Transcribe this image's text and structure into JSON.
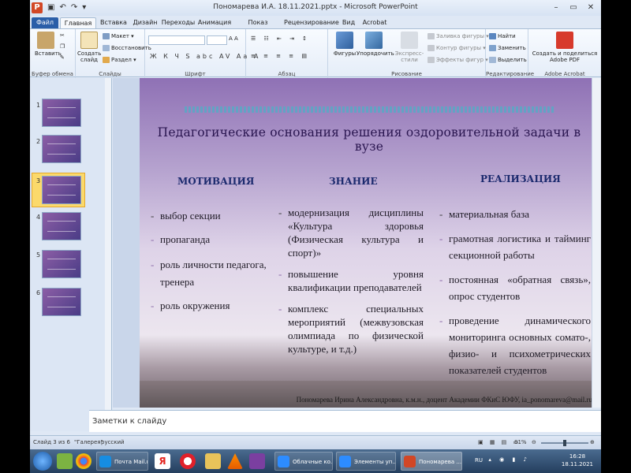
{
  "window": {
    "title": "Пономарева И.А. 18.11.2021.pptx - Microsoft PowerPoint",
    "controls": [
      "–",
      "▭",
      "✕"
    ]
  },
  "tabs": [
    "Файл",
    "Главная",
    "Вставка",
    "Дизайн",
    "Переходы",
    "Анимация",
    "Показ слайдов",
    "Рецензирование",
    "Вид",
    "Acrobat"
  ],
  "ribbon": {
    "clipboard": {
      "paste": "Вставить",
      "label": "Буфер обмена"
    },
    "slides": {
      "new_slide_l1": "Создать",
      "new_slide_l2": "слайд",
      "layout": "Макет",
      "reset": "Восстановить",
      "section": "Раздел",
      "label": "Слайды"
    },
    "font": {
      "format_row": "Ж К Ч S abc AV Aa A",
      "label": "Шрифт"
    },
    "paragraph": {
      "label": "Абзац"
    },
    "drawing": {
      "shapes": "Фигуры",
      "arrange": "Упорядочить",
      "quick_styles": "Экспресс-стили",
      "fill": "Заливка фигуры",
      "outline": "Контур фигуры",
      "effects": "Эффекты фигур",
      "label": "Рисование"
    },
    "editing": {
      "find": "Найти",
      "replace": "Заменить",
      "select": "Выделить",
      "label": "Редактирование"
    },
    "acrobat": {
      "create_l1": "Создать и поделиться",
      "create_l2": "Adobe PDF",
      "label": "Adobe Acrobat"
    }
  },
  "thumbnails": [
    "1",
    "2",
    "3",
    "4",
    "5",
    "6"
  ],
  "slide": {
    "title": "Педагогические основания решения оздоровительной задачи в вузе",
    "columns": [
      {
        "heading": "МОТИВАЦИЯ",
        "items": [
          "выбор секции",
          "пропаганда",
          "роль личности педагога, тренера",
          "роль окружения"
        ]
      },
      {
        "heading": "ЗНАНИЕ",
        "items": [
          "модернизация дисциплины «Культура здоровья (Физическая культура и спорт)»",
          "повышение уровня квалификации преподавателей",
          "комплекс специальных мероприятий (межвузовская олимпиада по физической культуре, и т.д.)"
        ]
      },
      {
        "heading": "РЕАЛИЗАЦИЯ",
        "items": [
          "материальная база",
          "грамотная логистика и тайминг секционной работы",
          "постоянная «обратная связь», опрос студентов",
          "проведение динамического мониторинга основных сомато-, физио- и психометрических показателей студентов"
        ]
      }
    ],
    "author": "Пономарева Ирина Александровна, к.м.н., доцент Академии ФКиС ЮФУ, ia_ponomareva@mail.ru"
  },
  "notes_placeholder": "Заметки к слайду",
  "status": {
    "slide_counter": "Слайд 3 из 6",
    "theme": "\"Галерея\"",
    "language": "русский",
    "zoom": "81%"
  },
  "taskbar": {
    "buttons": [
      "Почта Mail.ru ...",
      "Облачные ко...",
      "Элементы уп...",
      "Пономарева ..."
    ],
    "lang": "RU",
    "time": "16:28",
    "date": "18.11.2021"
  }
}
